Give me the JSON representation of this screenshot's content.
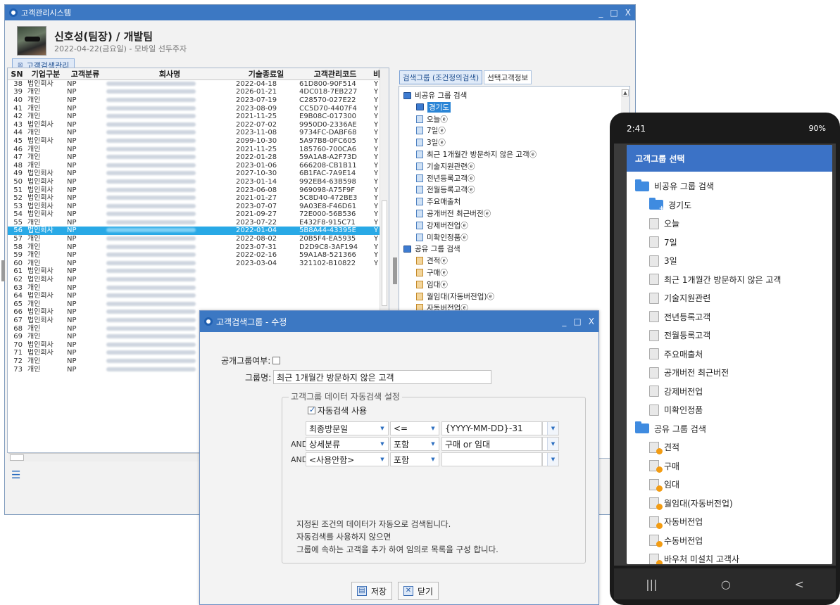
{
  "main_window": {
    "title": "고객관리시스템",
    "controls": [
      "_",
      "□",
      "X"
    ],
    "user_name": "신호성(팀장) / 개발팀",
    "user_sub": "2022-04-22(금요일) - 모바일 선두주자",
    "tab_label": "고객검색관리"
  },
  "grid": {
    "headers": [
      "SN",
      "기업구분",
      "고객분류",
      "회사명",
      "기술종료일",
      "고객관리코드",
      "비"
    ],
    "rows": [
      {
        "sn": "38",
        "type": "법인회사",
        "cls": "NP",
        "date": "2022-04-18",
        "code": "61D800-90F514",
        "flag": "Y"
      },
      {
        "sn": "39",
        "type": "개인",
        "cls": "NP",
        "date": "2026-01-21",
        "code": "4DC018-7EB227",
        "flag": "Y"
      },
      {
        "sn": "40",
        "type": "개인",
        "cls": "NP",
        "date": "2023-07-19",
        "code": "C28570-027E22",
        "flag": "Y"
      },
      {
        "sn": "41",
        "type": "개인",
        "cls": "NP",
        "date": "2023-08-09",
        "code": "CC5D70-4407F4",
        "flag": "Y"
      },
      {
        "sn": "42",
        "type": "개인",
        "cls": "NP",
        "date": "2021-11-25",
        "code": "E9B08C-017300",
        "flag": "Y"
      },
      {
        "sn": "43",
        "type": "법인회사",
        "cls": "NP",
        "date": "2022-07-02",
        "code": "9950D0-2336AE",
        "flag": "Y"
      },
      {
        "sn": "44",
        "type": "개인",
        "cls": "NP",
        "date": "2023-11-08",
        "code": "9734FC-DABF68",
        "flag": "Y"
      },
      {
        "sn": "45",
        "type": "법인회사",
        "cls": "NP",
        "date": "2099-10-30",
        "code": "5A97B8-0FC605",
        "flag": "Y"
      },
      {
        "sn": "46",
        "type": "개인",
        "cls": "NP",
        "date": "2021-11-25",
        "code": "185760-700CA6",
        "flag": "Y"
      },
      {
        "sn": "47",
        "type": "개인",
        "cls": "NP",
        "date": "2022-01-28",
        "code": "59A1A8-A2F73D",
        "flag": "Y"
      },
      {
        "sn": "48",
        "type": "개인",
        "cls": "NP",
        "date": "2023-01-06",
        "code": "666208-CB1B11",
        "flag": "Y"
      },
      {
        "sn": "49",
        "type": "법인회사",
        "cls": "NP",
        "date": "2027-10-30",
        "code": "6B1FAC-7A9E14",
        "flag": "Y"
      },
      {
        "sn": "50",
        "type": "법인회사",
        "cls": "NP",
        "date": "2023-01-14",
        "code": "992EB4-63B598",
        "flag": "Y"
      },
      {
        "sn": "51",
        "type": "법인회사",
        "cls": "NP",
        "date": "2023-06-08",
        "code": "969098-A75F9F",
        "flag": "Y"
      },
      {
        "sn": "52",
        "type": "법인회사",
        "cls": "NP",
        "date": "2021-01-27",
        "code": "5C8D40-472BE3",
        "flag": "Y"
      },
      {
        "sn": "53",
        "type": "법인회사",
        "cls": "NP",
        "date": "2023-07-07",
        "code": "9A03E8-F46D61",
        "flag": "Y"
      },
      {
        "sn": "54",
        "type": "법인회사",
        "cls": "NP",
        "date": "2021-09-27",
        "code": "72E000-56B536",
        "flag": "Y"
      },
      {
        "sn": "55",
        "type": "개인",
        "cls": "NP",
        "date": "2023-07-22",
        "code": "E432F8-915C71",
        "flag": "Y"
      },
      {
        "sn": "56",
        "type": "법인회사",
        "cls": "NP",
        "date": "2022-01-04",
        "code": "5B8A44-43395E",
        "flag": "Y"
      },
      {
        "sn": "57",
        "type": "개인",
        "cls": "NP",
        "date": "2022-08-02",
        "code": "20B5F4-EA5935",
        "flag": "Y"
      },
      {
        "sn": "58",
        "type": "개인",
        "cls": "NP",
        "date": "2023-07-31",
        "code": "D2D9C8-3AF194",
        "flag": "Y"
      },
      {
        "sn": "59",
        "type": "개인",
        "cls": "NP",
        "date": "2022-02-16",
        "code": "59A1A8-521366",
        "flag": "Y"
      },
      {
        "sn": "60",
        "type": "개인",
        "cls": "NP",
        "date": "2023-03-04",
        "code": "321102-B10822",
        "flag": "Y"
      },
      {
        "sn": "61",
        "type": "법인회사",
        "cls": "NP",
        "date": "",
        "code": "",
        "flag": ""
      },
      {
        "sn": "62",
        "type": "법인회사",
        "cls": "NP",
        "date": "",
        "code": "",
        "flag": ""
      },
      {
        "sn": "63",
        "type": "개인",
        "cls": "NP",
        "date": "",
        "code": "",
        "flag": ""
      },
      {
        "sn": "64",
        "type": "법인회사",
        "cls": "NP",
        "date": "",
        "code": "",
        "flag": ""
      },
      {
        "sn": "65",
        "type": "개인",
        "cls": "NP",
        "date": "",
        "code": "",
        "flag": ""
      },
      {
        "sn": "66",
        "type": "법인회사",
        "cls": "NP",
        "date": "",
        "code": "",
        "flag": ""
      },
      {
        "sn": "67",
        "type": "법인회사",
        "cls": "NP",
        "date": "",
        "code": "",
        "flag": ""
      },
      {
        "sn": "68",
        "type": "개인",
        "cls": "NP",
        "date": "",
        "code": "",
        "flag": ""
      },
      {
        "sn": "69",
        "type": "개인",
        "cls": "NP",
        "date": "",
        "code": "",
        "flag": ""
      },
      {
        "sn": "70",
        "type": "법인회사",
        "cls": "NP",
        "date": "",
        "code": "",
        "flag": ""
      },
      {
        "sn": "71",
        "type": "법인회사",
        "cls": "NP",
        "date": "",
        "code": "",
        "flag": ""
      },
      {
        "sn": "72",
        "type": "개인",
        "cls": "NP",
        "date": "",
        "code": "",
        "flag": ""
      },
      {
        "sn": "73",
        "type": "개인",
        "cls": "NP",
        "date": "",
        "code": "",
        "flag": ""
      }
    ],
    "selected_sn": "56"
  },
  "right_pane": {
    "tabs": [
      "검색그룹 (조건정의검색)",
      "선택고객정보"
    ],
    "tree": [
      {
        "label": "비공유 그룹 검색",
        "icon": "group"
      },
      {
        "label": "경기도",
        "icon": "group-add",
        "selected": true
      },
      {
        "label": "오늘ⓔ",
        "icon": "doc"
      },
      {
        "label": "7일ⓔ",
        "icon": "doc"
      },
      {
        "label": "3일ⓔ",
        "icon": "doc"
      },
      {
        "label": "최근 1개월간 방문하지 않은 고객ⓔ",
        "icon": "doc"
      },
      {
        "label": "기술지원관련ⓔ",
        "icon": "doc"
      },
      {
        "label": "전년등록고객ⓔ",
        "icon": "doc"
      },
      {
        "label": "전월등록고객ⓔ",
        "icon": "doc"
      },
      {
        "label": "주요매출처",
        "icon": "doc"
      },
      {
        "label": "공개버전 최근버전ⓔ",
        "icon": "doc"
      },
      {
        "label": "강제버전업ⓔ",
        "icon": "doc"
      },
      {
        "label": "미확인정품ⓔ",
        "icon": "doc"
      },
      {
        "label": "공유 그룹 검색",
        "icon": "group"
      },
      {
        "label": "견적ⓔ",
        "icon": "star"
      },
      {
        "label": "구매ⓔ",
        "icon": "star"
      },
      {
        "label": "임대ⓔ",
        "icon": "star"
      },
      {
        "label": "월임대(자동버전업)ⓔ",
        "icon": "star"
      },
      {
        "label": "자동버전업ⓔ",
        "icon": "star"
      }
    ]
  },
  "dialog": {
    "title": "고객검색그룹 - 수정",
    "controls": [
      "_",
      "□",
      "X"
    ],
    "public_label": "공개그룹여부:",
    "name_label": "그룹명:",
    "name_value": "최근 1개월간 방문하지 않은 고객",
    "fieldset_legend": "고객그룹 데이터 자동검색 설정",
    "auto_search_label": "자동검색 사용",
    "conditions": [
      {
        "conj": "",
        "field": "최종방문일",
        "op": "<=",
        "value": "{YYYY-MM-DD}-31"
      },
      {
        "conj": "AND",
        "field": "상세분류",
        "op": "포함",
        "value": "구매 or 임대"
      },
      {
        "conj": "AND",
        "field": "<사용안함>",
        "op": "포함",
        "value": ""
      }
    ],
    "info_lines": [
      "지정된 조건의 데이터가 자동으로 검색됩니다.",
      "자동검색를 사용하지 않으면",
      "그룹에 속하는 고객을 추가 하여 임의로 목록을 구성 합니다."
    ],
    "save_label": "저장",
    "close_label": "닫기"
  },
  "phone": {
    "time": "2:41",
    "status_right": "90%",
    "sheet_title": "고객그룹 선택",
    "items": [
      {
        "label": "비공유 그룹 검색",
        "icon": "folder",
        "indent": 0
      },
      {
        "label": "경기도",
        "icon": "folder-add",
        "indent": 1
      },
      {
        "label": "오늘",
        "icon": "doc",
        "indent": 1
      },
      {
        "label": "7일",
        "icon": "doc",
        "indent": 1
      },
      {
        "label": "3일",
        "icon": "doc",
        "indent": 1
      },
      {
        "label": "최근 1개월간 방문하지 않은 고객",
        "icon": "doc",
        "indent": 1
      },
      {
        "label": "기술지원관련",
        "icon": "doc",
        "indent": 1
      },
      {
        "label": "전년등록고객",
        "icon": "doc",
        "indent": 1
      },
      {
        "label": "전월등록고객",
        "icon": "doc",
        "indent": 1
      },
      {
        "label": "주요매출처",
        "icon": "doc",
        "indent": 1
      },
      {
        "label": "공개버전 최근버전",
        "icon": "doc",
        "indent": 1
      },
      {
        "label": "강제버전업",
        "icon": "doc",
        "indent": 1
      },
      {
        "label": "미확인정품",
        "icon": "doc",
        "indent": 1
      },
      {
        "label": "공유 그룹 검색",
        "icon": "folder",
        "indent": 0
      },
      {
        "label": "견적",
        "icon": "star",
        "indent": 1
      },
      {
        "label": "구매",
        "icon": "star",
        "indent": 1
      },
      {
        "label": "임대",
        "icon": "star",
        "indent": 1
      },
      {
        "label": "월임대(자동버전업)",
        "icon": "star",
        "indent": 1
      },
      {
        "label": "자동버전업",
        "icon": "star",
        "indent": 1
      },
      {
        "label": "수동버전업",
        "icon": "star",
        "indent": 1
      },
      {
        "label": "바우처 미설치 고객사",
        "icon": "star",
        "indent": 1
      }
    ],
    "nav": [
      "|||",
      "○",
      "<"
    ]
  }
}
